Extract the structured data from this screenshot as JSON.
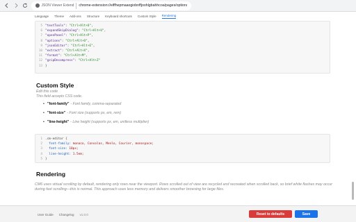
{
  "browser": {
    "chip_label": "JSON Viewer Extend",
    "url": "chrome-extension://eiffhepmaaogiobnffjoohlgbahhcoa/pages/options.html"
  },
  "tabs": [
    {
      "label": "Language"
    },
    {
      "label": "Theme"
    },
    {
      "label": "Add-ons"
    },
    {
      "label": "Structure"
    },
    {
      "label": "Keyboard shortcuts"
    },
    {
      "label": "Custom Style"
    },
    {
      "label": "Rendering"
    }
  ],
  "shortcuts_code": [
    {
      "num": "5",
      "key": "\"textTools\"",
      "val": "\"Ctrl+Alt+O\""
    },
    {
      "num": "6",
      "key": "\"expandSkipDialog\"",
      "val": "\"Ctrl+Alt+U\""
    },
    {
      "num": "7",
      "key": "\"openPanel\"",
      "val": "\"Ctrl+Alt+P\""
    },
    {
      "num": "8",
      "key": "\"options\"",
      "val": "\"Ctrl+Alt+O\""
    },
    {
      "num": "9",
      "key": "\"jsonEditor\"",
      "val": "\"Ctrl+Alt+E\""
    },
    {
      "num": "10",
      "key": "\"extract\"",
      "val": "\"Ctrl+Alt+X\""
    },
    {
      "num": "11",
      "key": "\"format\"",
      "val": "\"Ctrl+Alt+M\""
    },
    {
      "num": "12",
      "key": "\"gzipDecompress\"",
      "val": "\"Ctrl+Alt+Z\""
    },
    {
      "num": "13",
      "key": "}",
      "val": ""
    }
  ],
  "custom_style": {
    "title": "Custom Style",
    "note1": "Edit this code",
    "note2": "This field accepts CSS code.",
    "bullets": [
      {
        "prop": "\"font-family\"",
        "desc": "- Font family, comma-separated"
      },
      {
        "prop": "\"font-size\"",
        "desc": "- Font size (supports px, em, rem)"
      },
      {
        "prop": "\"line-height\"",
        "desc": "- Line height (supports px, em, unitless multiplier)"
      }
    ],
    "code": [
      {
        "num": "1",
        "text": ".cm-editor {"
      },
      {
        "num": "2",
        "prop": "font-family:",
        "val": "monaco, Consolas, Menlo, Courier, monospace;"
      },
      {
        "num": "3",
        "prop": "font-size:",
        "val": "10px;"
      },
      {
        "num": "4",
        "prop": "line-height:",
        "val": "1.5em;"
      },
      {
        "num": "5",
        "text": "}"
      }
    ]
  },
  "rendering": {
    "title": "Rendering",
    "text": "CM6 uses virtual scrolling by default, rendering only rows near the viewport. Rows scrolled out of view are recycled and recreated when scrolled back, so brief white flashes may occur during fast scrolling—this is normal. This approach uses less memory and delivers smoother browsing for large files."
  },
  "footer": {
    "user_guide": "User Guide",
    "changelog": "Changelog",
    "version": "v1.0.0",
    "reset_label": "Reset to defaults",
    "save_label": "Save"
  },
  "colors": {
    "accent": "#1a73e8",
    "danger": "#d93a3a"
  }
}
